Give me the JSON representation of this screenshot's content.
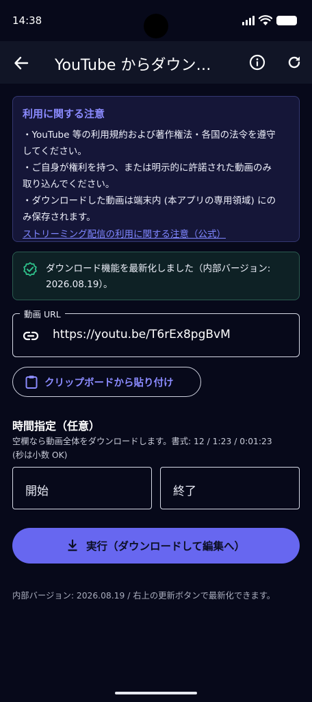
{
  "status_bar": {
    "time": "14:38"
  },
  "app_bar": {
    "title": "YouTube からダウンロード",
    "icons": [
      "arrow-back-icon",
      "info-icon",
      "refresh-icon"
    ]
  },
  "notice": {
    "title": "利用に関する注意",
    "lines": [
      "・YouTube 等の利用規約および著作権法・各国の法令を遵守",
      "してください。",
      "・ご自身が権利を持つ、または明示的に許諾された動画のみ",
      "取り込んでください。",
      "・ダウンロードした動画は端末内 (本アプリの専用領域) にの",
      "み保存されます。"
    ],
    "link": "ストリーミング配信の利用に関する注意（公式）"
  },
  "success": {
    "line1": "ダウンロード機能を最新化しました（内部バージョン:",
    "line2": "2026.08.19）。"
  },
  "url_field": {
    "label": "動画 URL",
    "value": "https://youtu.be/T6rEx8pgBvM"
  },
  "paste_button": {
    "label": "クリップボードから貼り付け"
  },
  "time_section": {
    "title": "時間指定（任意）",
    "help_line1": "空欄なら動画全体をダウンロードします。書式: 12 / 1:23 / 0:01:23",
    "help_line2": "(秒は小数 OK)",
    "start_placeholder": "開始",
    "end_placeholder": "終了"
  },
  "run_button": {
    "label": "実行（ダウンロードして編集へ）"
  },
  "footer": {
    "note": "内部バージョン: 2026.08.19 / 右上の更新ボタンで最新化できます。"
  },
  "colors": {
    "background": "#07091a",
    "accent": "#6767f0",
    "success": "#2fc08a"
  }
}
